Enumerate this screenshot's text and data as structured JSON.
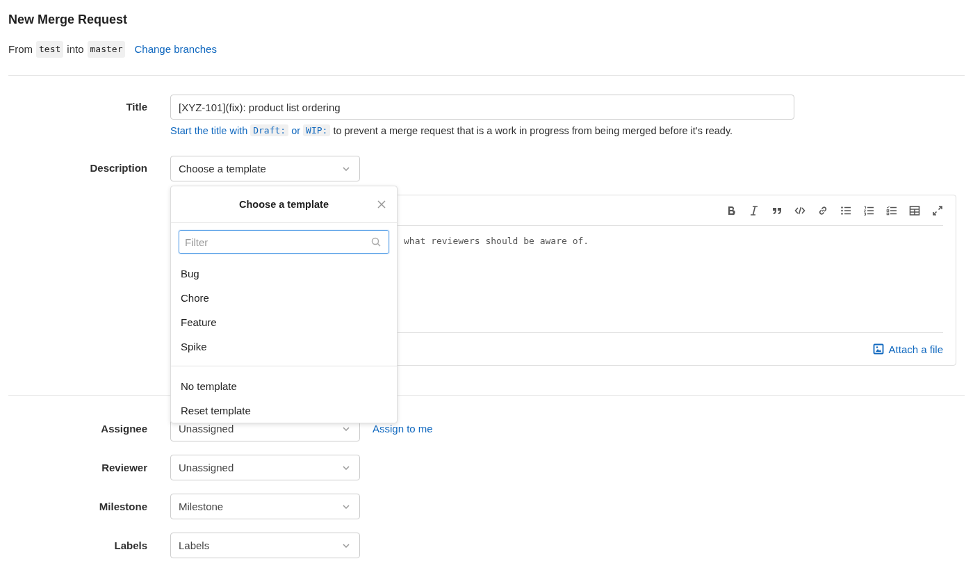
{
  "page": {
    "title": "New Merge Request"
  },
  "branches": {
    "from_label": "From",
    "source": "test",
    "into_label": "into",
    "target": "master",
    "link": "Change branches"
  },
  "title_field": {
    "label": "Title",
    "value": "[XYZ-101](fix): product list ordering",
    "hint": [
      {
        "kind": "link",
        "text": "Start the title with"
      },
      {
        "kind": "code",
        "text": "Draft:"
      },
      {
        "kind": "link",
        "text": "or"
      },
      {
        "kind": "code",
        "text": "WIP:"
      },
      {
        "kind": "text",
        "text": "to prevent a merge request that is a work in progress from being merged before it's ready."
      }
    ]
  },
  "description": {
    "label": "Description",
    "template_select": "Choose a template",
    "editor_text": "what reviewers should be aware of.",
    "attach": "Attach a file"
  },
  "template_dropdown": {
    "title": "Choose a template",
    "filter_placeholder": "Filter",
    "templates": [
      "Bug",
      "Chore",
      "Feature",
      "Spike"
    ],
    "actions": [
      "No template",
      "Reset template"
    ]
  },
  "fields": [
    {
      "label": "Assignee",
      "value": "Unassigned",
      "link": "Assign to me"
    },
    {
      "label": "Reviewer",
      "value": "Unassigned"
    },
    {
      "label": "Milestone",
      "value": "Milestone"
    },
    {
      "label": "Labels",
      "value": "Labels"
    }
  ]
}
